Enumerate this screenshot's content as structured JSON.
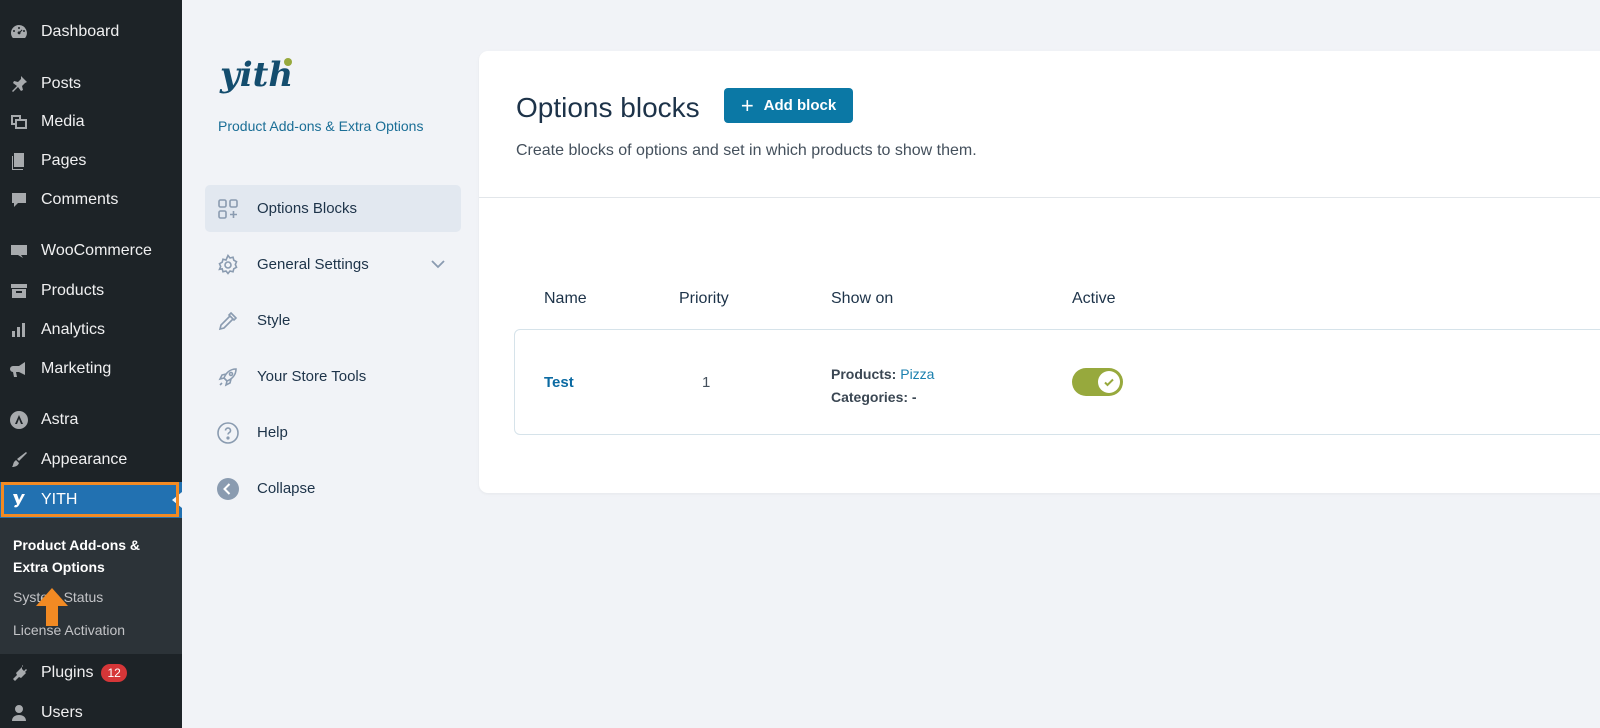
{
  "wp_menu": {
    "items": [
      {
        "label": "Dashboard",
        "icon": "dashboard-icon"
      },
      {
        "label": "Posts",
        "icon": "pin-icon"
      },
      {
        "label": "Media",
        "icon": "media-icon"
      },
      {
        "label": "Pages",
        "icon": "pages-icon"
      },
      {
        "label": "Comments",
        "icon": "comment-icon"
      },
      {
        "label": "WooCommerce",
        "icon": "woo-icon"
      },
      {
        "label": "Products",
        "icon": "archive-icon"
      },
      {
        "label": "Analytics",
        "icon": "bar-chart-icon"
      },
      {
        "label": "Marketing",
        "icon": "megaphone-icon"
      },
      {
        "label": "Astra",
        "icon": "astra-icon"
      },
      {
        "label": "Appearance",
        "icon": "brush-icon"
      },
      {
        "label": "YITH",
        "icon": "yith-icon"
      },
      {
        "label": "Plugins",
        "icon": "plug-icon",
        "badge": "12"
      },
      {
        "label": "Users",
        "icon": "user-icon"
      }
    ],
    "submenu": [
      {
        "label": "Product Add-ons & Extra Options"
      },
      {
        "label": "System Status"
      },
      {
        "label": "License Activation"
      }
    ],
    "highlight_color": "#f28a23"
  },
  "yith_nav": {
    "logo_text": "yith",
    "plugin_name": "Product Add-ons & Extra Options",
    "items": [
      {
        "label": "Options Blocks",
        "icon": "blocks-grid-icon"
      },
      {
        "label": "General Settings",
        "icon": "gear-icon"
      },
      {
        "label": "Style",
        "icon": "eyedropper-icon"
      },
      {
        "label": "Your Store Tools",
        "icon": "rocket-icon"
      },
      {
        "label": "Help",
        "icon": "help-circle-icon"
      },
      {
        "label": "Collapse",
        "icon": "collapse-arrow-icon"
      }
    ]
  },
  "main": {
    "title": "Options blocks",
    "add_button": "Add block",
    "description": "Create blocks of options and set in which products to show them.",
    "table": {
      "headers": [
        "Name",
        "Priority",
        "Show on",
        "Active"
      ],
      "rows": [
        {
          "name": "Test",
          "priority": "1",
          "products_label": "Products:",
          "products_value": "Pizza",
          "categories_label": "Categories:",
          "categories_value": "-",
          "active": true
        }
      ]
    },
    "accent_color": "#0b78a5",
    "toggle_color": "#97a93d"
  }
}
